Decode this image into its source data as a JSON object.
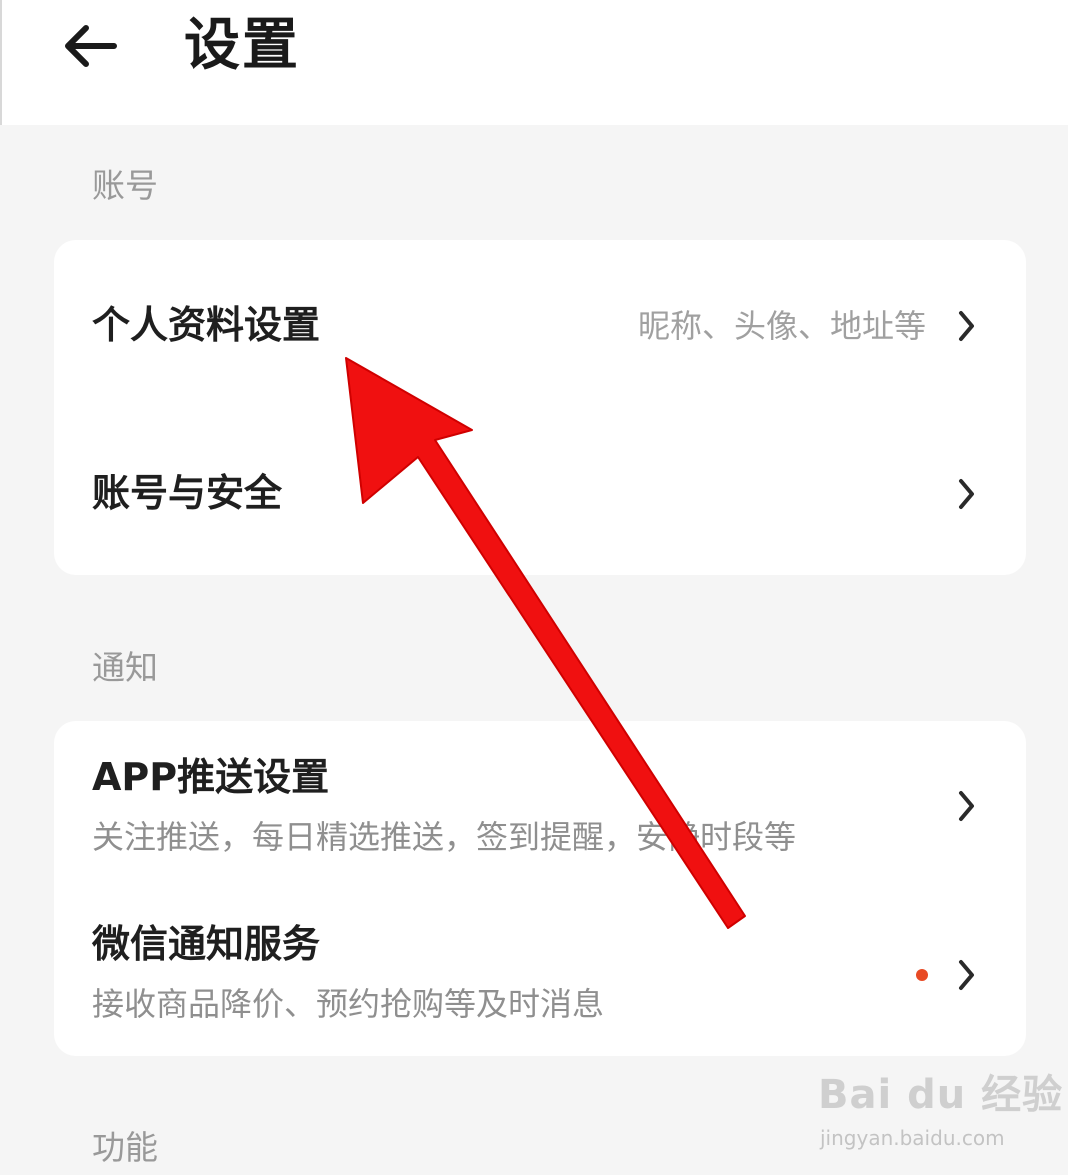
{
  "header": {
    "title": "设置",
    "back_icon": "arrow-left-icon"
  },
  "sections": {
    "account": {
      "label": "账号",
      "items": [
        {
          "title": "个人资料设置",
          "hint": "昵称、头像、地址等"
        },
        {
          "title": "账号与安全"
        }
      ]
    },
    "notify": {
      "label": "通知",
      "items": [
        {
          "title": "APP推送设置",
          "subtitle": "关注推送，每日精选推送，签到提醒，安静时段等"
        },
        {
          "title": "微信通知服务",
          "subtitle": "接收商品降价、预约抢购等及时消息",
          "badge": "red-dot"
        }
      ]
    },
    "features": {
      "label": "功能"
    }
  },
  "watermark": {
    "brand": "Bai du 经验",
    "url": "jingyan.baidu.com"
  },
  "colors": {
    "annotation_arrow": "#f01010",
    "badge_dot": "#e84a24",
    "background": "#f5f5f5"
  }
}
